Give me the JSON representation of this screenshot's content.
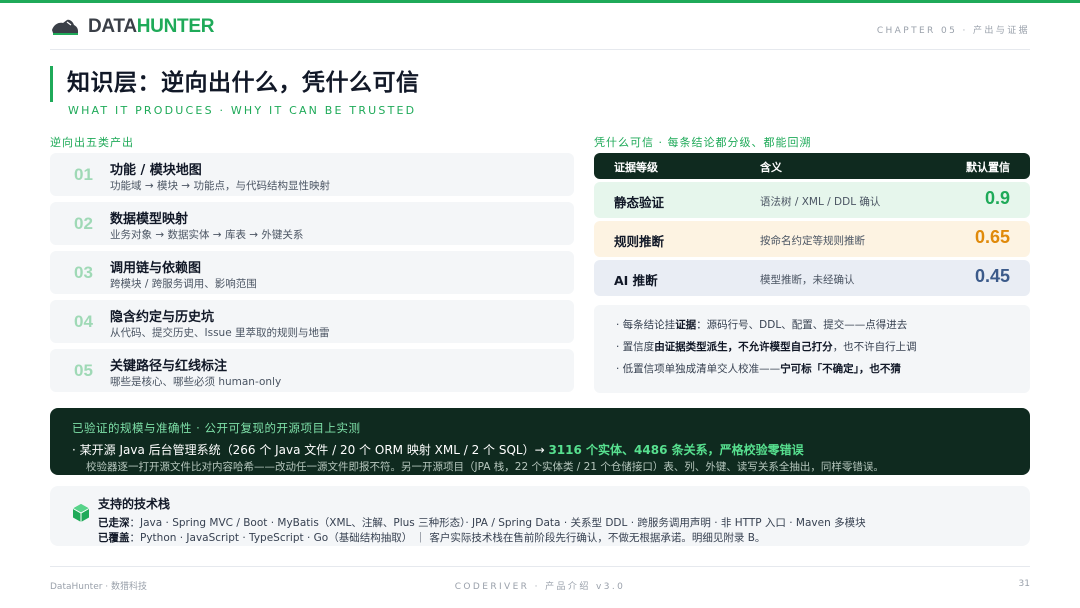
{
  "colors": {
    "accent": "#1faa59",
    "dark": "#0f2a1f",
    "static_bg": "#e6f6ec",
    "rule_bg": "#fdf3e2",
    "ai_bg": "#e9edf4"
  },
  "header": {
    "logo_prefix": "DATA",
    "logo_suffix": "HUNTER",
    "logo_icon": "sneaker-logo-icon",
    "chapter": "CHAPTER 05 · 产出与证据"
  },
  "title": {
    "main": "知识层：逆向出什么，凭什么可信",
    "sub": "WHAT IT PRODUCES · WHY IT CAN BE TRUSTED"
  },
  "outputs": {
    "label": "逆向出五类产出",
    "items": [
      {
        "num": "01",
        "title": "功能 / 模块地图",
        "desc": "功能域 → 模块 → 功能点，与代码结构显性映射"
      },
      {
        "num": "02",
        "title": "数据模型映射",
        "desc": "业务对象 → 数据实体 → 库表 → 外键关系"
      },
      {
        "num": "03",
        "title": "调用链与依赖图",
        "desc": "跨模块 / 跨服务调用、影响范围"
      },
      {
        "num": "04",
        "title": "隐含约定与历史坑",
        "desc": "从代码、提交历史、Issue 里萃取的规则与地雷"
      },
      {
        "num": "05",
        "title": "关键路径与红线标注",
        "desc": "哪些是核心、哪些必须 human-only"
      }
    ]
  },
  "trust": {
    "label": "凭什么可信 · 每条结论都分级、都能回溯",
    "headers": {
      "level": "证据等级",
      "meaning": "含义",
      "score": "默认置信"
    },
    "rows": [
      {
        "level": "静态验证",
        "meaning": "语法树 / XML / DDL 确认",
        "score": "0.9",
        "score_color": "#1faa59"
      },
      {
        "level": "规则推断",
        "meaning": "按命名约定等规则推断",
        "score": "0.65",
        "score_color": "#e08a0b"
      },
      {
        "level": "AI 推断",
        "meaning": "模型推断，未经确认",
        "score": "0.45",
        "score_color": "#3b5a8a"
      }
    ],
    "notes": [
      {
        "pre": "· 每条结论挂",
        "bold": "证据",
        "post": "：源码行号、DDL、配置、提交——点得进去"
      },
      {
        "pre": "· 置信度",
        "bold": "由证据类型派生，不允许模型自己打分",
        "post": "，也不许自行上调"
      },
      {
        "pre": "· 低置信项单独成清单交人校准——",
        "bold": "宁可标「不确定」，也不猜",
        "post": ""
      }
    ]
  },
  "verify": {
    "title": "已验证的规模与准确性 · 公开可复现的开源项目上实测",
    "line1_pre": "· 某开源 Java 后台管理系统（266 个 Java 文件 / 20 个 ORM 映射 XML / 2 个 SQL）→ ",
    "line1_highlight": "3116 个实体、4486 条关系，严格校验零错误",
    "line2": "校验器逐一打开源文件比对内容哈希——改动任一源文件即报不符。另一开源项目（JPA 栈，22 个实体类 / 21 个仓储接口）表、列、外键、读写关系全抽出，同样零错误。"
  },
  "stack": {
    "title": "支持的技术栈",
    "icon": "cube-icon",
    "deep_label": "已走深",
    "deep_text": "：Java · Spring MVC / Boot · MyBatis（XML、注解、Plus 三种形态）· JPA / Spring Data · 关系型 DDL · 跨服务调用声明 · 非 HTTP 入口 · Maven 多模块",
    "cover_label": "已覆盖",
    "cover_text": "：Python · JavaScript · TypeScript · Go（基础结构抽取）  ｜  客户实际技术栈在售前阶段先行确认，不做无根据承诺。明细见附录 B。"
  },
  "footer": {
    "left": "DataHunter · 数猎科技",
    "center": "CODERIVER · 产品介绍 v3.0",
    "page": "31"
  }
}
